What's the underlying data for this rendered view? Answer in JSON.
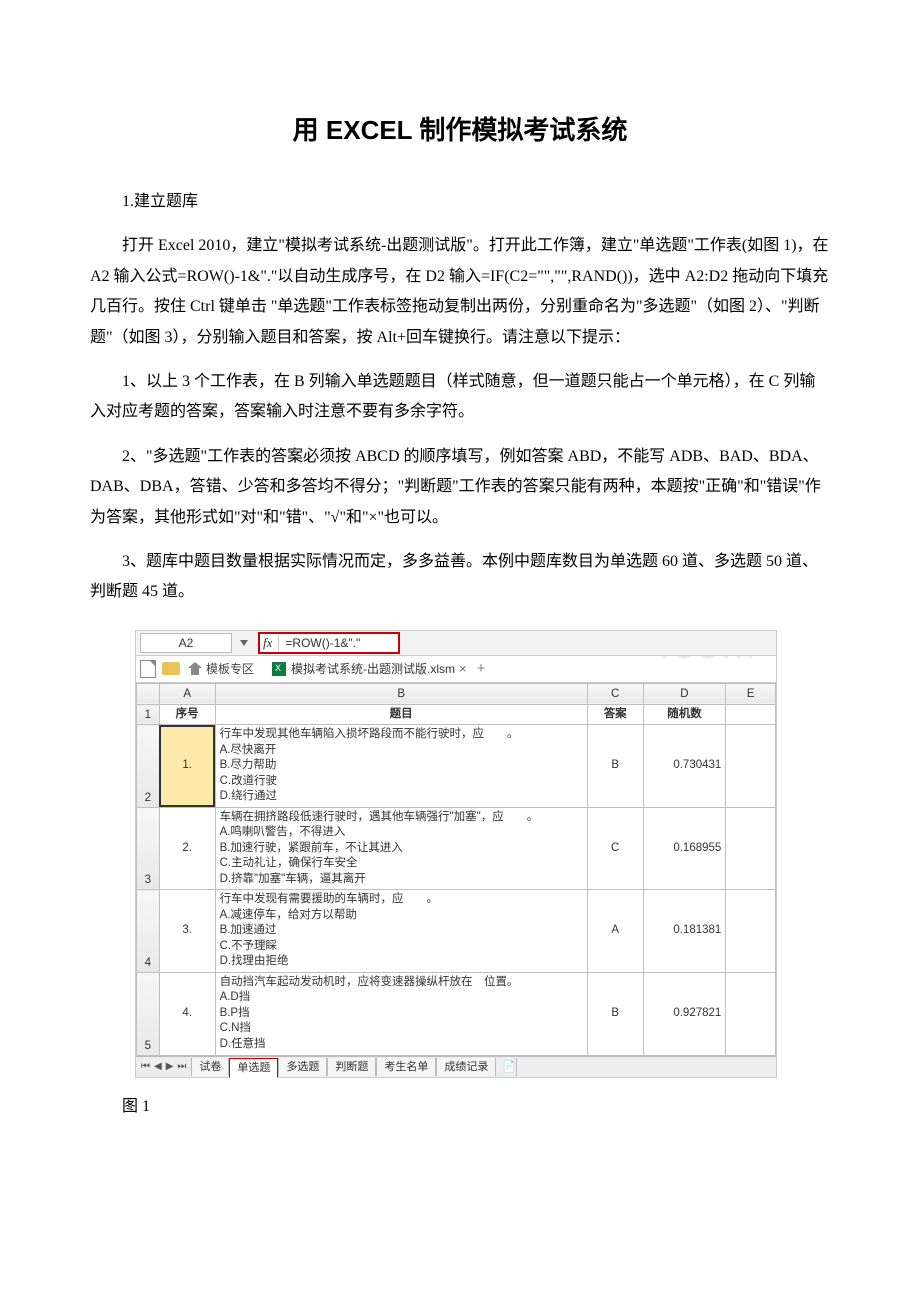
{
  "title": "用 EXCEL 制作模拟考试系统",
  "section1": "1.建立题库",
  "para1": "打开 Excel 2010，建立\"模拟考试系统-出题测试版\"。打开此工作簿，建立\"单选题\"工作表(如图 1)，在 A2 输入公式=ROW()-1&\".\"以自动生成序号，在 D2 输入=IF(C2=\"\",\"\",RAND())，选中 A2:D2 拖动向下填充几百行。按住 Ctrl 键单击 \"单选题\"工作表标签拖动复制出两份，分别重命名为\"多选题\"（如图 2）、\"判断题\"（如图 3），分别输入题目和答案，按 Alt+回车键换行。请注意以下提示：",
  "para2": "1、以上 3 个工作表，在 B 列输入单选题题目（样式随意，但一道题只能占一个单元格），在 C 列输入对应考题的答案，答案输入时注意不要有多余字符。",
  "para3": "2、\"多选题\"工作表的答案必须按 ABCD 的顺序填写，例如答案 ABD，不能写 ADB、BAD、BDA、DAB、DBA，答错、少答和多答均不得分；\"判断题\"工作表的答案只能有两种，本题按\"正确\"和\"错误\"作为答案，其他形式如\"对\"和\"错\"、\"√\"和\"×\"也可以。",
  "para4": "3、题库中题目数量根据实际情况而定，多多益善。本例中题库数目为单选题 60 道、多选题 50 道、判断题 45 道。",
  "fig1_caption": "图 1",
  "watermark": ".com",
  "excel": {
    "namebox": "A2",
    "fx": "fx",
    "formula": "=ROW()-1&\".\"",
    "template_zone": "模板专区",
    "filename": "模拟考试系统-出题测试版.xlsm",
    "cols": [
      "A",
      "B",
      "C",
      "D",
      "E"
    ],
    "headers": {
      "A": "序号",
      "B": "题目",
      "C": "答案",
      "D": "随机数",
      "E": ""
    },
    "rows": [
      {
        "r": "2",
        "no": "1.",
        "q": "行车中发现其他车辆陷入损坏路段而不能行驶时，应　　。\nA.尽快离开\nB.尽力帮助\nC.改道行驶\nD.绕行通过",
        "ans": "B",
        "rand": "0.730431"
      },
      {
        "r": "3",
        "no": "2.",
        "q": "车辆在拥挤路段低速行驶时，遇其他车辆强行\"加塞\"，应　　。\nA.鸣喇叭警告，不得进入\nB.加速行驶，紧跟前车，不让其进入\nC.主动礼让，确保行车安全\nD.挤靠\"加塞\"车辆，逼其离开",
        "ans": "C",
        "rand": "0.168955"
      },
      {
        "r": "4",
        "no": "3.",
        "q": "行车中发现有需要援助的车辆时，应　　。\nA.减速停车，给对方以帮助\nB.加速通过\nC.不予理睬\nD.找理由拒绝",
        "ans": "A",
        "rand": "0.181381"
      },
      {
        "r": "5",
        "no": "4.",
        "q": "自动挡汽车起动发动机时，应将变速器操纵杆放在　位置。\nA.D挡\nB.P挡\nC.N挡\nD.任意挡",
        "ans": "B",
        "rand": "0.927821"
      }
    ],
    "sheets": [
      "试卷",
      "单选题",
      "多选题",
      "判断题",
      "考生名单",
      "成绩记录"
    ]
  }
}
